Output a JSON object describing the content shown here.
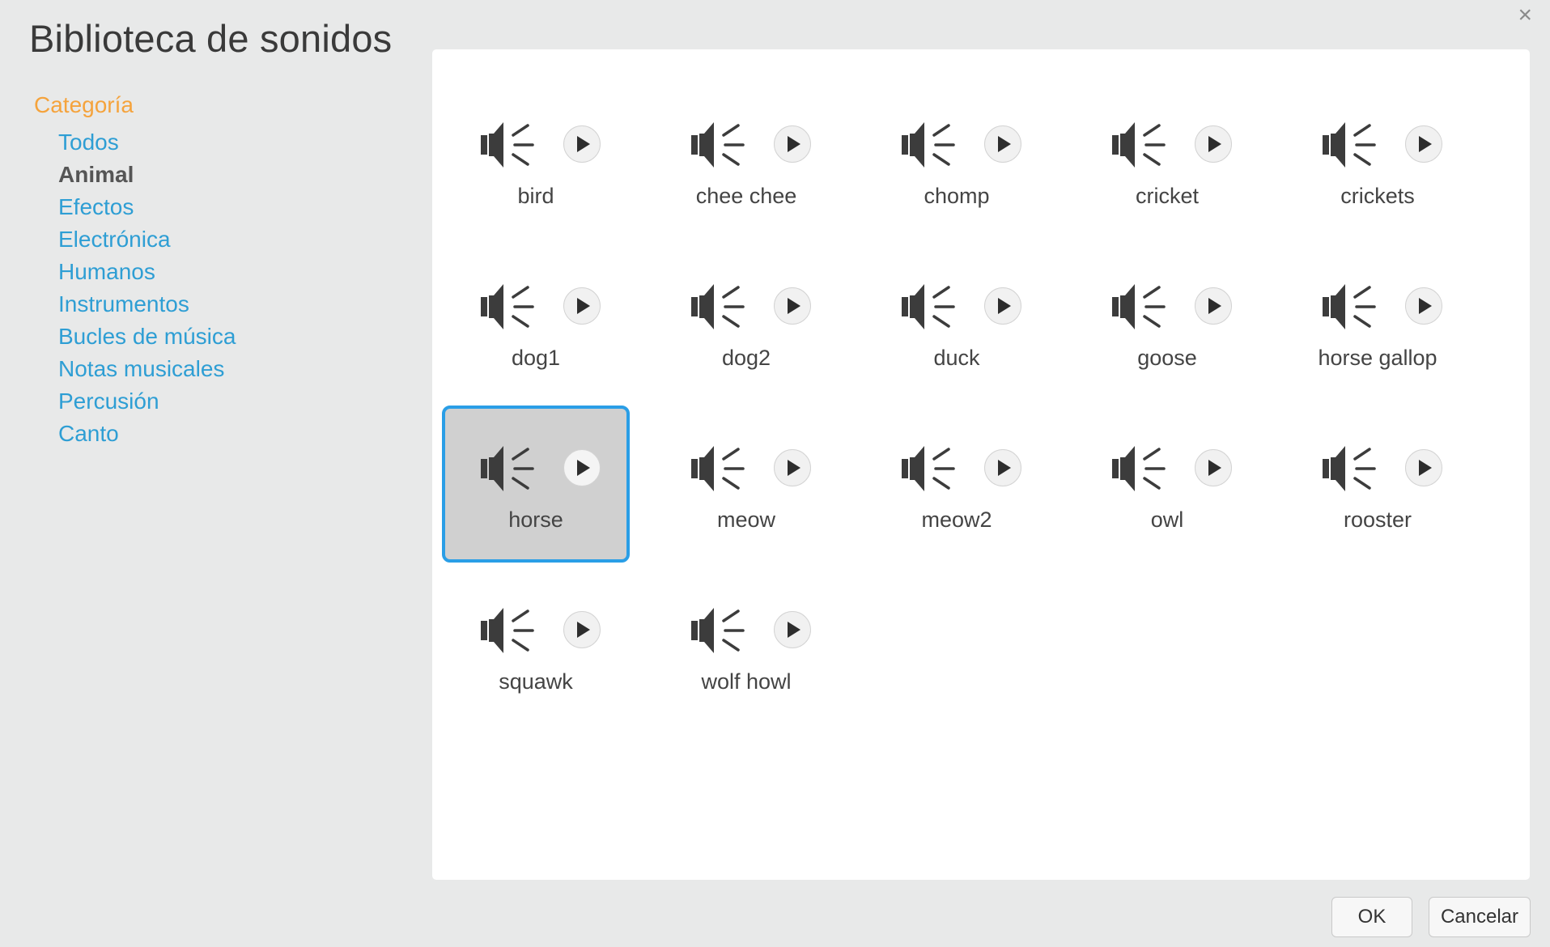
{
  "dialog": {
    "title": "Biblioteca de sonidos",
    "close_label": "×"
  },
  "sidebar": {
    "heading": "Categoría",
    "items": [
      {
        "label": "Todos",
        "selected": false
      },
      {
        "label": "Animal",
        "selected": true
      },
      {
        "label": "Efectos",
        "selected": false
      },
      {
        "label": "Electrónica",
        "selected": false
      },
      {
        "label": "Humanos",
        "selected": false
      },
      {
        "label": "Instrumentos",
        "selected": false
      },
      {
        "label": "Bucles de música",
        "selected": false
      },
      {
        "label": "Notas musicales",
        "selected": false
      },
      {
        "label": "Percusión",
        "selected": false
      },
      {
        "label": "Canto",
        "selected": false
      }
    ]
  },
  "sounds": [
    {
      "name": "bird",
      "selected": false
    },
    {
      "name": "chee chee",
      "selected": false
    },
    {
      "name": "chomp",
      "selected": false
    },
    {
      "name": "cricket",
      "selected": false
    },
    {
      "name": "crickets",
      "selected": false
    },
    {
      "name": "dog1",
      "selected": false
    },
    {
      "name": "dog2",
      "selected": false
    },
    {
      "name": "duck",
      "selected": false
    },
    {
      "name": "goose",
      "selected": false
    },
    {
      "name": "horse gallop",
      "selected": false
    },
    {
      "name": "horse",
      "selected": true
    },
    {
      "name": "meow",
      "selected": false
    },
    {
      "name": "meow2",
      "selected": false
    },
    {
      "name": "owl",
      "selected": false
    },
    {
      "name": "rooster",
      "selected": false
    },
    {
      "name": "squawk",
      "selected": false
    },
    {
      "name": "wolf howl",
      "selected": false
    }
  ],
  "icons": {
    "sound": "speaker-icon",
    "play": "play-icon"
  },
  "footer": {
    "ok_label": "OK",
    "cancel_label": "Cancelar"
  },
  "colors": {
    "accent": "#2e9ed4",
    "heading": "#f5a33c",
    "selection_border": "#2a9ee6"
  }
}
